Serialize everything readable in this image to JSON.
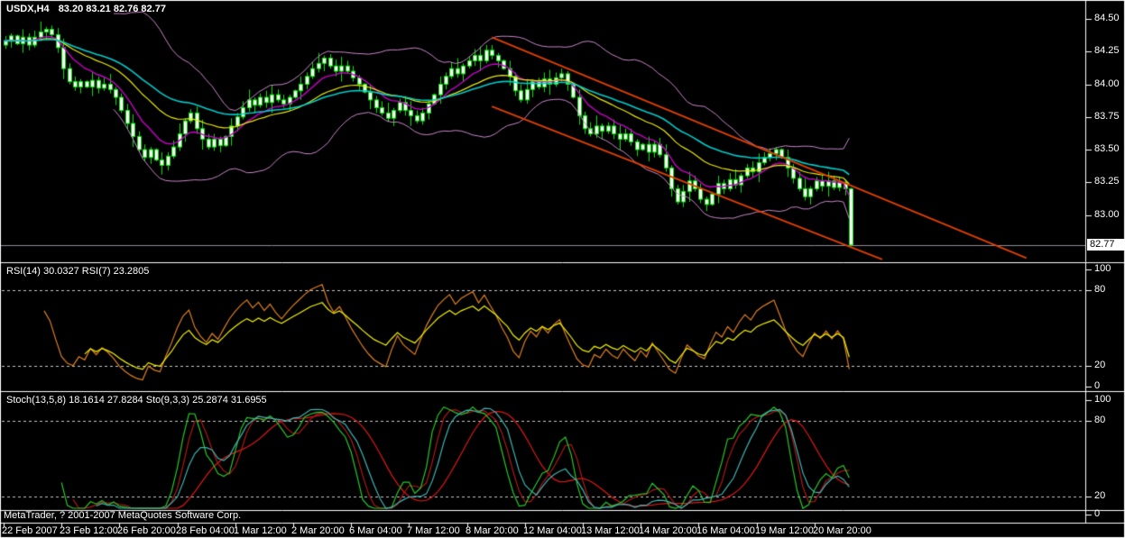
{
  "header": {
    "symbol_period": "USDX,H4",
    "ohlc_values": "83.20 83.21 82.76 82.77"
  },
  "panels": {
    "main": {
      "price_axis_labels": [
        "84.50",
        "84.25",
        "84.00",
        "83.75",
        "83.50",
        "83.25",
        "83.00"
      ],
      "price_axis_values": [
        84.5,
        84.25,
        84.0,
        83.75,
        83.5,
        83.25,
        83.0
      ],
      "current_price_tag": "82.77"
    },
    "rsi": {
      "label": "RSI(14) 30.0327  RSI(7) 23.2805",
      "axis_labels": [
        "100",
        "80",
        "20",
        "0"
      ],
      "axis_values": [
        100,
        80,
        20,
        0
      ]
    },
    "stoch": {
      "label": "Stoch(13,5,8) 18.1614 27.8284  Sto(9,3,3) 25.2874 31.6955",
      "axis_labels": [
        "100",
        "80",
        "20",
        "0"
      ],
      "axis_values": [
        100,
        80,
        20,
        0
      ]
    }
  },
  "time_axis": {
    "labels": [
      "22 Feb 2007",
      "23 Feb 12:00",
      "26 Feb 20:00",
      "28 Feb 04:00",
      "1 Mar 12:00",
      "2 Mar 20:00",
      "6 Mar 04:00",
      "7 Mar 12:00",
      "8 Mar 20:00",
      "12 Mar 04:00",
      "13 Mar 12:00",
      "14 Mar 20:00",
      "16 Mar 04:00",
      "19 Mar 12:00",
      "20 Mar 20:00"
    ],
    "tick_bars": [
      0,
      10,
      20,
      30,
      40,
      50,
      60,
      70,
      80,
      90,
      100,
      110,
      120,
      130,
      140
    ]
  },
  "footer": {
    "copyright": "MetaTrader, ? 2001-2007 MetaQuotes Software Corp."
  },
  "colors": {
    "background": "#000000",
    "frame": "#FFFFFF",
    "candle_border": "#00E400",
    "candle_fill": "#FFFFFF",
    "bollinger_band": "#C987C9",
    "ma_magenta": "#C800C8",
    "ma_yellow": "#E8E800",
    "ma_cyan": "#00CCCC",
    "trendline": "#E04000",
    "price_line": "#8C8C94",
    "level_dash": "#C8C8C8",
    "rsi14": "#F0F000",
    "rsi7": "#E08020",
    "stoch_k_main": "#40B4B4",
    "stoch_d_main": "#E01818",
    "stoch_k_alt": "#28C828",
    "stoch_d_alt": "#B01818",
    "tag_bg": "#FFFFFF",
    "tag_text": "#000000"
  },
  "chart_data": [
    {
      "type": "candlestick",
      "title": "USDX,H4 83.20 83.21 82.76 82.77",
      "symbol": "USDX",
      "timeframe": "H4",
      "ylim": [
        82.6,
        84.64
      ],
      "y_ticks": [
        84.5,
        84.25,
        84.0,
        83.75,
        83.5,
        83.25,
        83.0
      ],
      "current_price": 82.77,
      "first_open": 84.3,
      "closes": [
        84.33,
        84.37,
        84.31,
        84.36,
        84.3,
        84.36,
        84.4,
        84.42,
        84.38,
        84.28,
        84.12,
        84.02,
        83.98,
        84.02,
        83.98,
        84.03,
        83.97,
        84.0,
        83.96,
        83.9,
        83.8,
        83.7,
        83.6,
        83.5,
        83.44,
        83.5,
        83.42,
        83.38,
        83.45,
        83.52,
        83.62,
        83.72,
        83.78,
        83.66,
        83.58,
        83.52,
        83.58,
        83.53,
        83.6,
        83.68,
        83.75,
        83.82,
        83.88,
        83.84,
        83.9,
        83.86,
        83.92,
        83.88,
        83.85,
        83.9,
        83.95,
        84.0,
        84.06,
        84.12,
        84.16,
        84.2,
        84.14,
        84.1,
        84.14,
        84.1,
        84.05,
        84.0,
        83.94,
        83.88,
        83.82,
        83.78,
        83.74,
        83.8,
        83.86,
        83.8,
        83.76,
        83.72,
        83.78,
        83.85,
        83.92,
        84.0,
        84.06,
        84.12,
        84.08,
        84.14,
        84.18,
        84.22,
        84.18,
        84.26,
        84.22,
        84.18,
        84.12,
        84.06,
        83.95,
        83.88,
        83.96,
        84.02,
        83.98,
        84.04,
        84.0,
        84.05,
        84.08,
        84.0,
        83.9,
        83.76,
        83.66,
        83.62,
        83.68,
        83.64,
        83.68,
        83.62,
        83.58,
        83.62,
        83.56,
        83.5,
        83.54,
        83.48,
        83.54,
        83.46,
        83.36,
        83.2,
        83.1,
        83.18,
        83.26,
        83.2,
        83.12,
        83.08,
        83.16,
        83.24,
        83.2,
        83.27,
        83.23,
        83.3,
        83.36,
        83.33,
        83.4,
        83.44,
        83.47,
        83.5,
        83.44,
        83.36,
        83.28,
        83.2,
        83.14,
        83.2,
        83.26,
        83.22,
        83.26,
        83.21,
        83.25,
        83.2,
        82.77
      ],
      "wicks_high": [
        0.04,
        0.02,
        0.01,
        0.06,
        0.03,
        0.05,
        0.08,
        0.02,
        0.03,
        0.05,
        0.07,
        0.04
      ],
      "wicks_low": [
        0.03,
        0.05,
        0.01,
        0.07,
        0.04,
        0.02,
        0.03,
        0.06,
        0.02,
        0.04,
        0.08,
        0.02
      ],
      "overlays": {
        "bollinger": {
          "period": 20,
          "deviation": 2
        },
        "ema_fast": 9,
        "ema_mid": 21,
        "ema_slow": 34
      },
      "trendlines": [
        {
          "bar1": 84.3,
          "price1": 84.36,
          "bar2": 176.6,
          "price2": 82.67
        },
        {
          "bar1": 84.3,
          "price1": 83.83,
          "bar2": 151.7,
          "price2": 82.66
        }
      ],
      "horizontal_line_price": 82.77
    },
    {
      "type": "line",
      "panel": "rsi",
      "ylim": [
        0,
        100
      ],
      "levels": [
        80,
        20
      ],
      "computed_from": "main.closes",
      "series": [
        {
          "name": "RSI(14)",
          "period": 14,
          "color_key": "rsi14",
          "last_value": 30.0327
        },
        {
          "name": "RSI(7)",
          "period": 7,
          "color_key": "rsi7",
          "last_value": 23.2805
        }
      ]
    },
    {
      "type": "line",
      "panel": "stoch",
      "ylim": [
        0,
        100
      ],
      "levels": [
        80,
        20
      ],
      "computed_from": "main.ohlc",
      "series": [
        {
          "name": "Stoch(13,5,8) %K",
          "params": [
            13,
            5,
            8
          ],
          "color_key": "stoch_k_main",
          "last_value": 18.1614
        },
        {
          "name": "Stoch(13,5,8) %D",
          "params": [
            13,
            5,
            8
          ],
          "color_key": "stoch_d_main",
          "last_value": 27.8284
        },
        {
          "name": "Sto(9,3,3) %K",
          "params": [
            9,
            3,
            3
          ],
          "color_key": "stoch_k_alt",
          "last_value": 25.2874
        },
        {
          "name": "Sto(9,3,3) %D",
          "params": [
            9,
            3,
            3
          ],
          "color_key": "stoch_d_alt",
          "last_value": 31.6955
        }
      ]
    }
  ]
}
